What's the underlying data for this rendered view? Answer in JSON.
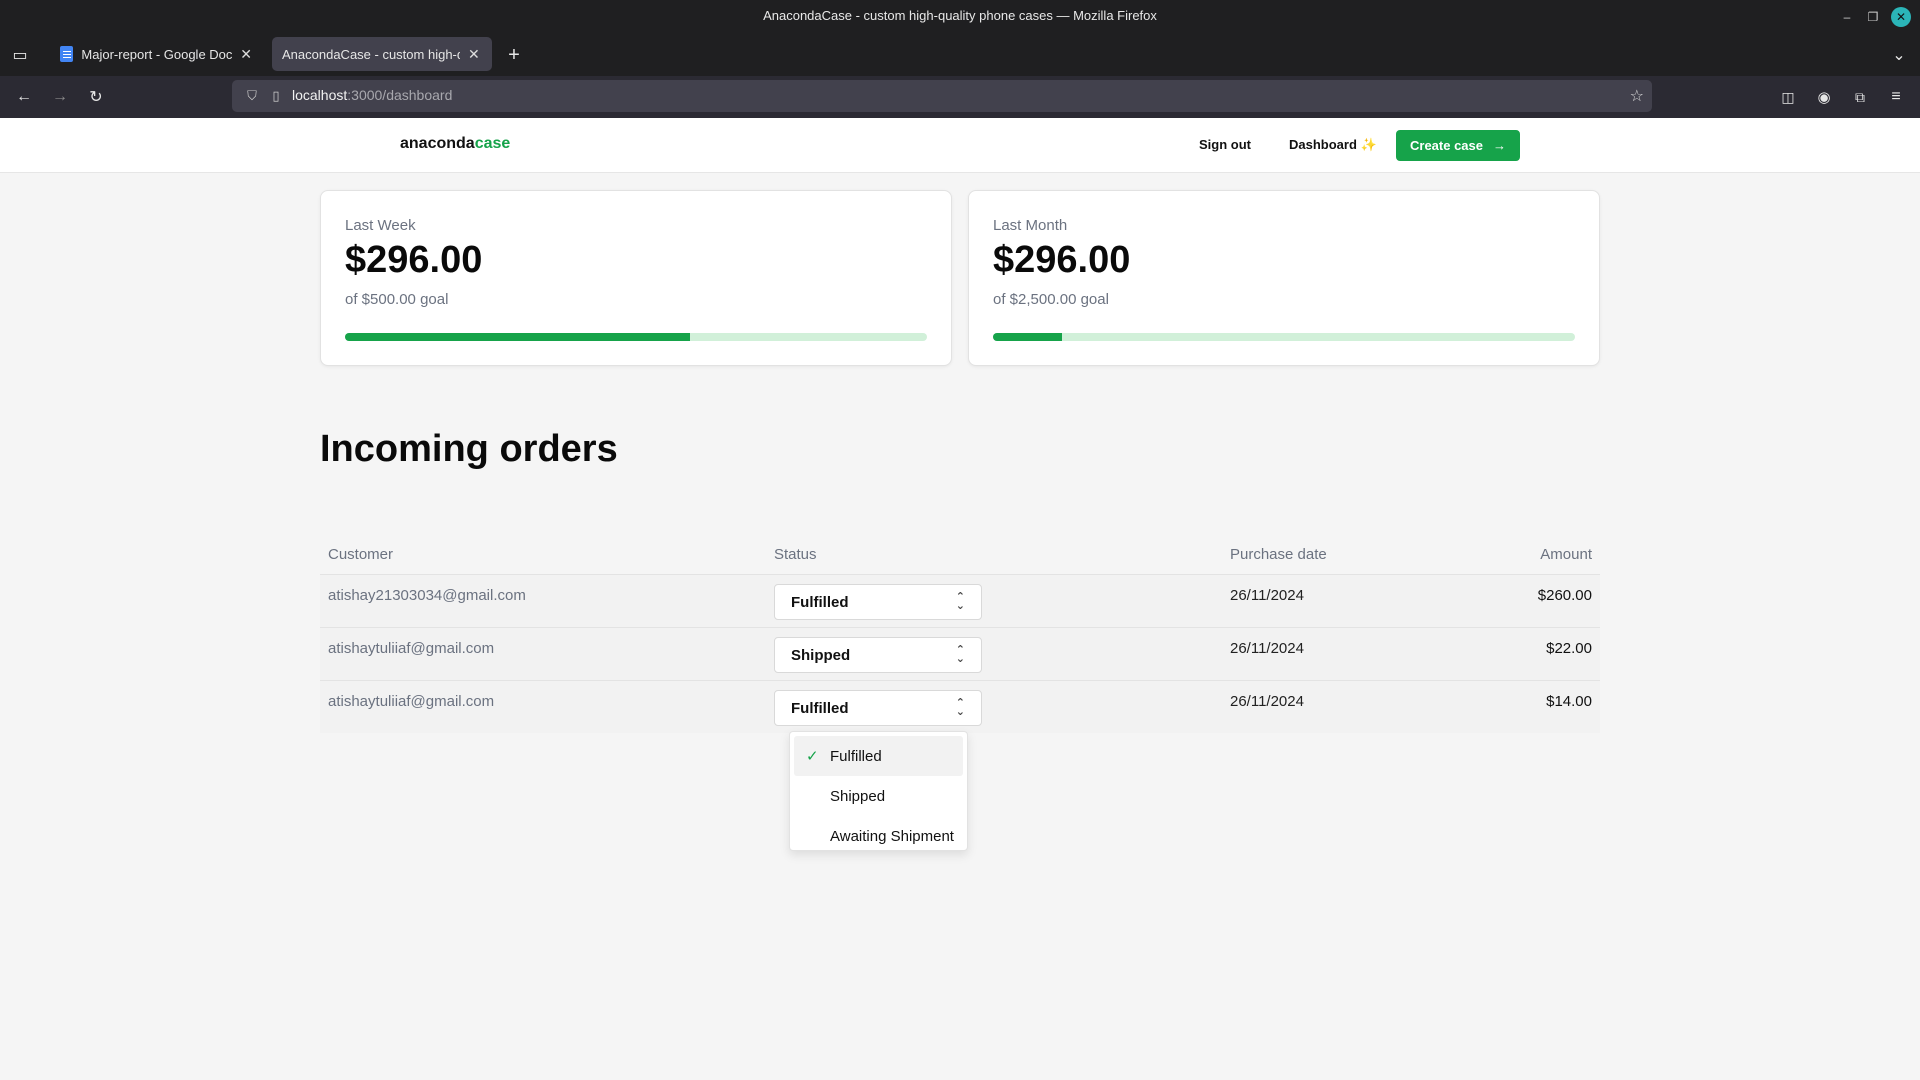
{
  "browser": {
    "window_title": "AnacondaCase - custom high-quality phone cases — Mozilla Firefox",
    "tabs": [
      {
        "label": "Major-report - Google Docs",
        "icon": "google-docs-icon"
      },
      {
        "label": "AnacondaCase - custom high-q",
        "icon": ""
      }
    ],
    "url_host": "localhost",
    "url_path": ":3000/dashboard"
  },
  "header": {
    "logo_part1": "anaconda",
    "logo_part2": "case",
    "sign_out": "Sign out",
    "dashboard": "Dashboard",
    "dashboard_sparkle": "✨",
    "create_case": "Create case"
  },
  "stats": [
    {
      "label": "Last Week",
      "value": "$296.00",
      "goal": "of $500.00 goal",
      "progress": 0.592
    },
    {
      "label": "Last Month",
      "value": "$296.00",
      "goal": "of $2,500.00 goal",
      "progress": 0.118
    }
  ],
  "orders": {
    "title": "Incoming orders",
    "columns": {
      "customer": "Customer",
      "status": "Status",
      "date": "Purchase date",
      "amount": "Amount"
    },
    "rows": [
      {
        "customer": "atishay21303034@gmail.com",
        "status": "Fulfilled",
        "date": "26/11/2024",
        "amount": "$260.00"
      },
      {
        "customer": "atishaytuliiaf@gmail.com",
        "status": "Shipped",
        "date": "26/11/2024",
        "amount": "$22.00"
      },
      {
        "customer": "atishaytuliiaf@gmail.com",
        "status": "Fulfilled",
        "date": "26/11/2024",
        "amount": "$14.00"
      }
    ]
  },
  "status_dropdown": {
    "options": [
      "Fulfilled",
      "Shipped",
      "Awaiting Shipment"
    ],
    "selected": "Fulfilled"
  },
  "colors": {
    "accent": "#16a34a",
    "track": "#d1f0d9"
  }
}
